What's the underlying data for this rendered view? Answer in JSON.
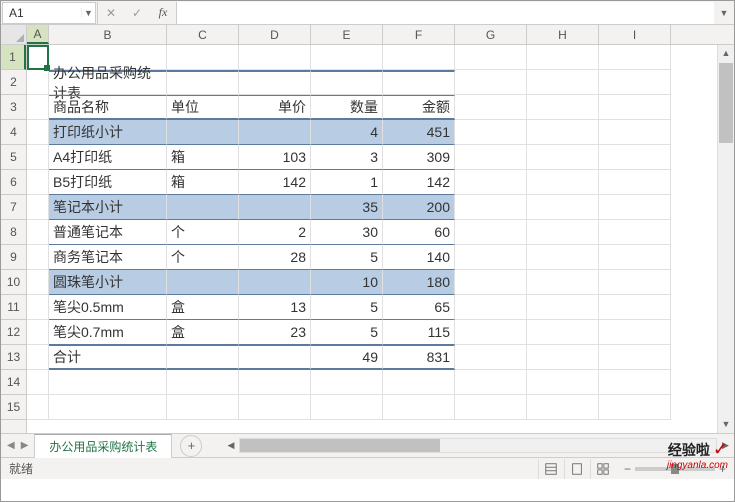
{
  "active_cell": "A1",
  "columns": [
    "A",
    "B",
    "C",
    "D",
    "E",
    "F",
    "G",
    "H",
    "I"
  ],
  "row_numbers": [
    1,
    2,
    3,
    4,
    5,
    6,
    7,
    8,
    9,
    10,
    11,
    12,
    13,
    14,
    15
  ],
  "table": {
    "title": "办公用品采购统计表",
    "headers": [
      "商品名称",
      "单位",
      "单价",
      "数量",
      "金额"
    ],
    "rows": [
      {
        "type": "subtotal",
        "name": "打印纸小计",
        "unit": "",
        "price": "",
        "qty": "4",
        "amount": "451"
      },
      {
        "type": "data",
        "name": "A4打印纸",
        "unit": "箱",
        "price": "103",
        "qty": "3",
        "amount": "309"
      },
      {
        "type": "data",
        "name": "B5打印纸",
        "unit": "箱",
        "price": "142",
        "qty": "1",
        "amount": "142"
      },
      {
        "type": "subtotal",
        "name": "笔记本小计",
        "unit": "",
        "price": "",
        "qty": "35",
        "amount": "200"
      },
      {
        "type": "data",
        "name": "普通笔记本",
        "unit": "个",
        "price": "2",
        "qty": "30",
        "amount": "60"
      },
      {
        "type": "data",
        "name": "商务笔记本",
        "unit": "个",
        "price": "28",
        "qty": "5",
        "amount": "140"
      },
      {
        "type": "subtotal",
        "name": "圆珠笔小计",
        "unit": "",
        "price": "",
        "qty": "10",
        "amount": "180"
      },
      {
        "type": "data",
        "name": "笔尖0.5mm",
        "unit": "盒",
        "price": "13",
        "qty": "5",
        "amount": "65"
      },
      {
        "type": "data",
        "name": "笔尖0.7mm",
        "unit": "盒",
        "price": "23",
        "qty": "5",
        "amount": "115"
      },
      {
        "type": "total",
        "name": "合计",
        "unit": "",
        "price": "",
        "qty": "49",
        "amount": "831"
      }
    ]
  },
  "sheet_tab": "办公用品采购统计表",
  "status": "就绪",
  "fb": {
    "cancel": "✕",
    "enter": "✓",
    "fx": "fx"
  },
  "watermark": {
    "logo": "经验啦",
    "site": "jingyanla.com"
  }
}
